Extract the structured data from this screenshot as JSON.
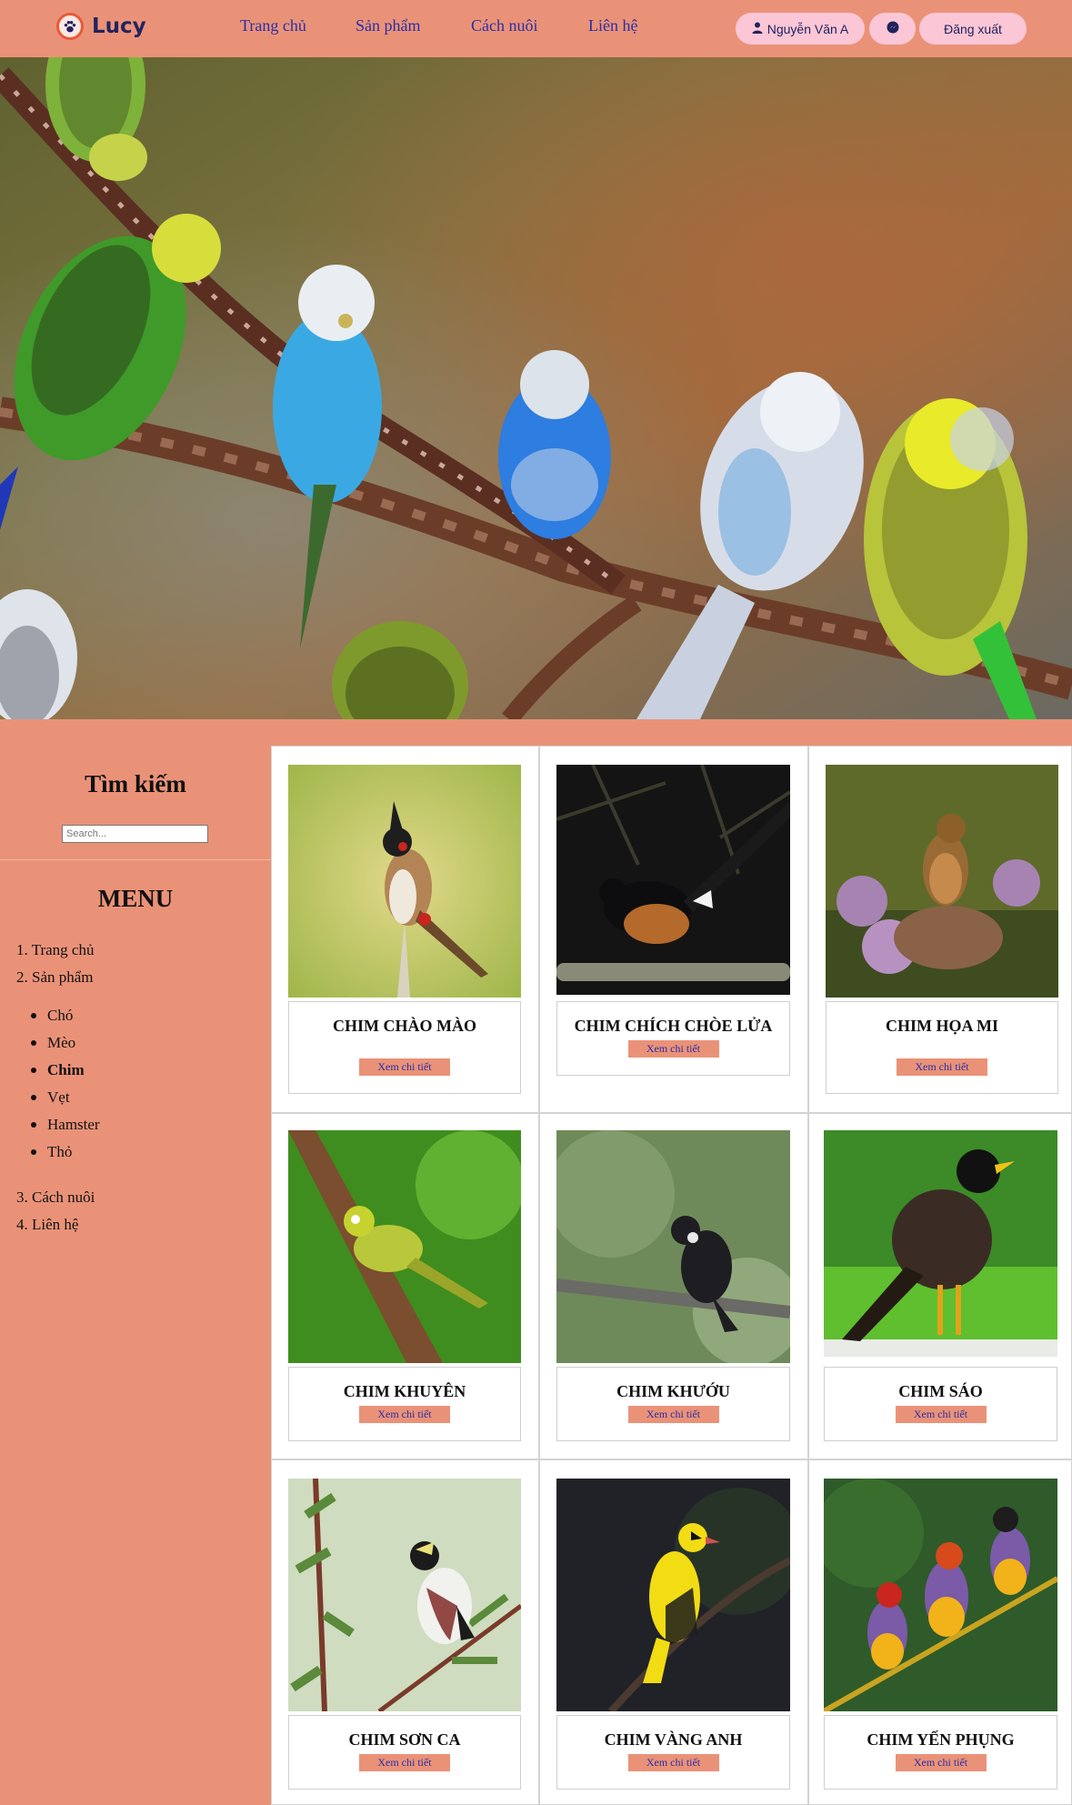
{
  "header": {
    "logo_text": "Lucy",
    "nav": [
      "Trang chủ",
      "Sản phẩm",
      "Cách nuôi",
      "Liên hệ"
    ],
    "user_name": "Nguyễn Văn A",
    "logout_label": "Đăng xuất",
    "icons": {
      "logo": "paw-icon",
      "user": "user-icon",
      "messenger": "messenger-icon"
    }
  },
  "hero": {
    "image": "budgerigars-on-branch-photo"
  },
  "sidebar": {
    "search_title": "Tìm kiếm",
    "search_placeholder": "Search...",
    "menu_title": "MENU",
    "menu_items": [
      "1. Trang chủ",
      "2. Sản phẩm",
      "3. Cách nuôi",
      "4. Liên hệ"
    ],
    "sub_items": [
      "Chó",
      "Mèo",
      "Chim",
      "Vẹt",
      "Hamster",
      "Thỏ"
    ],
    "active_sub_item": "Chim"
  },
  "products": [
    {
      "name": "CHIM CHÀO MÀO",
      "button": "Xem chi tiết"
    },
    {
      "name": "CHIM CHÍCH CHÒE LỬA",
      "button": "Xem chi tiết"
    },
    {
      "name": "CHIM HỌA MI",
      "button": "Xem chi tiết"
    },
    {
      "name": "CHIM KHUYÊN",
      "button": "Xem chi tiết"
    },
    {
      "name": "CHIM KHƯỚU",
      "button": "Xem chi tiết"
    },
    {
      "name": "CHIM SÁO",
      "button": "Xem chi tiết"
    },
    {
      "name": "CHIM SƠN CA",
      "button": "Xem chi tiết"
    },
    {
      "name": "CHIM VÀNG ANH",
      "button": "Xem chi tiết"
    },
    {
      "name": "CHIM YẾN PHỤNG",
      "button": "Xem chi tiết"
    }
  ],
  "colors": {
    "primary": "#ea9278",
    "nav_text": "#2a2fa6",
    "pill": "#fbc6d6",
    "logo_text": "#23245f"
  }
}
